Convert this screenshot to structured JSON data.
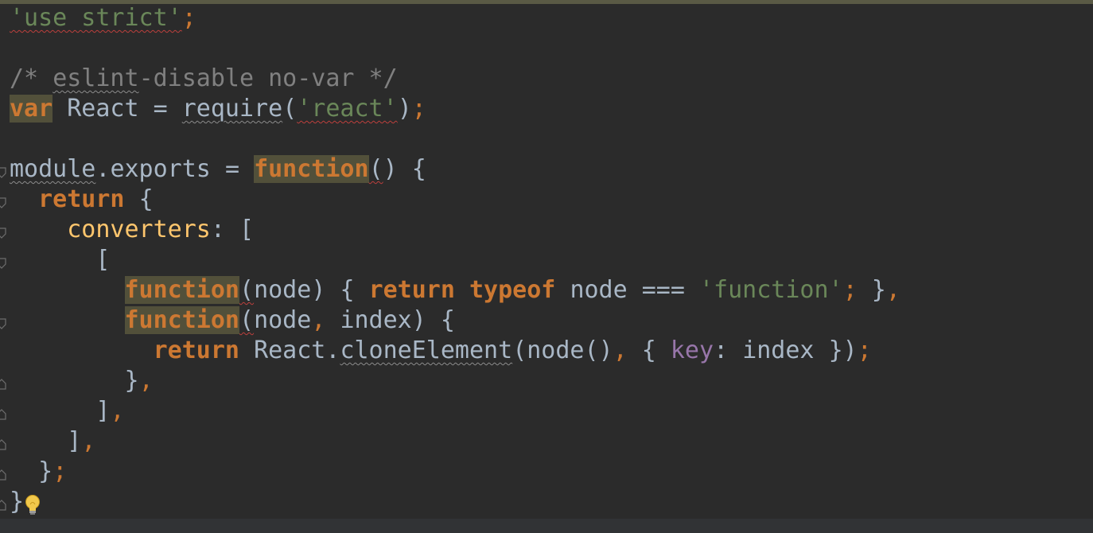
{
  "editor": {
    "language": "JavaScript",
    "theme": "dark",
    "lines": [
      "'use strict';",
      "",
      "/* eslint-disable no-var */",
      "var React = require('react');",
      "",
      "module.exports = function() {",
      "  return {",
      "    converters: [",
      "      [",
      "        function(node) { return typeof node === 'function'; },",
      "        function(node, index) {",
      "          return React.cloneElement(node(), { key: index });",
      "        },",
      "      ],",
      "    ],",
      "  };",
      "}"
    ]
  },
  "icons": {
    "fold_open": "fold-open-icon",
    "fold_close": "fold-close-icon",
    "intention": "lightbulb-icon"
  },
  "colors": {
    "background": "#2b2b2b",
    "keyword": "#cc7832",
    "string": "#6a8759",
    "comment": "#808080",
    "text": "#a9b7c6",
    "property": "#ffc66d",
    "object_key": "#9876aa",
    "highlight": "#52503a",
    "error_underline": "#bc3f3c"
  }
}
